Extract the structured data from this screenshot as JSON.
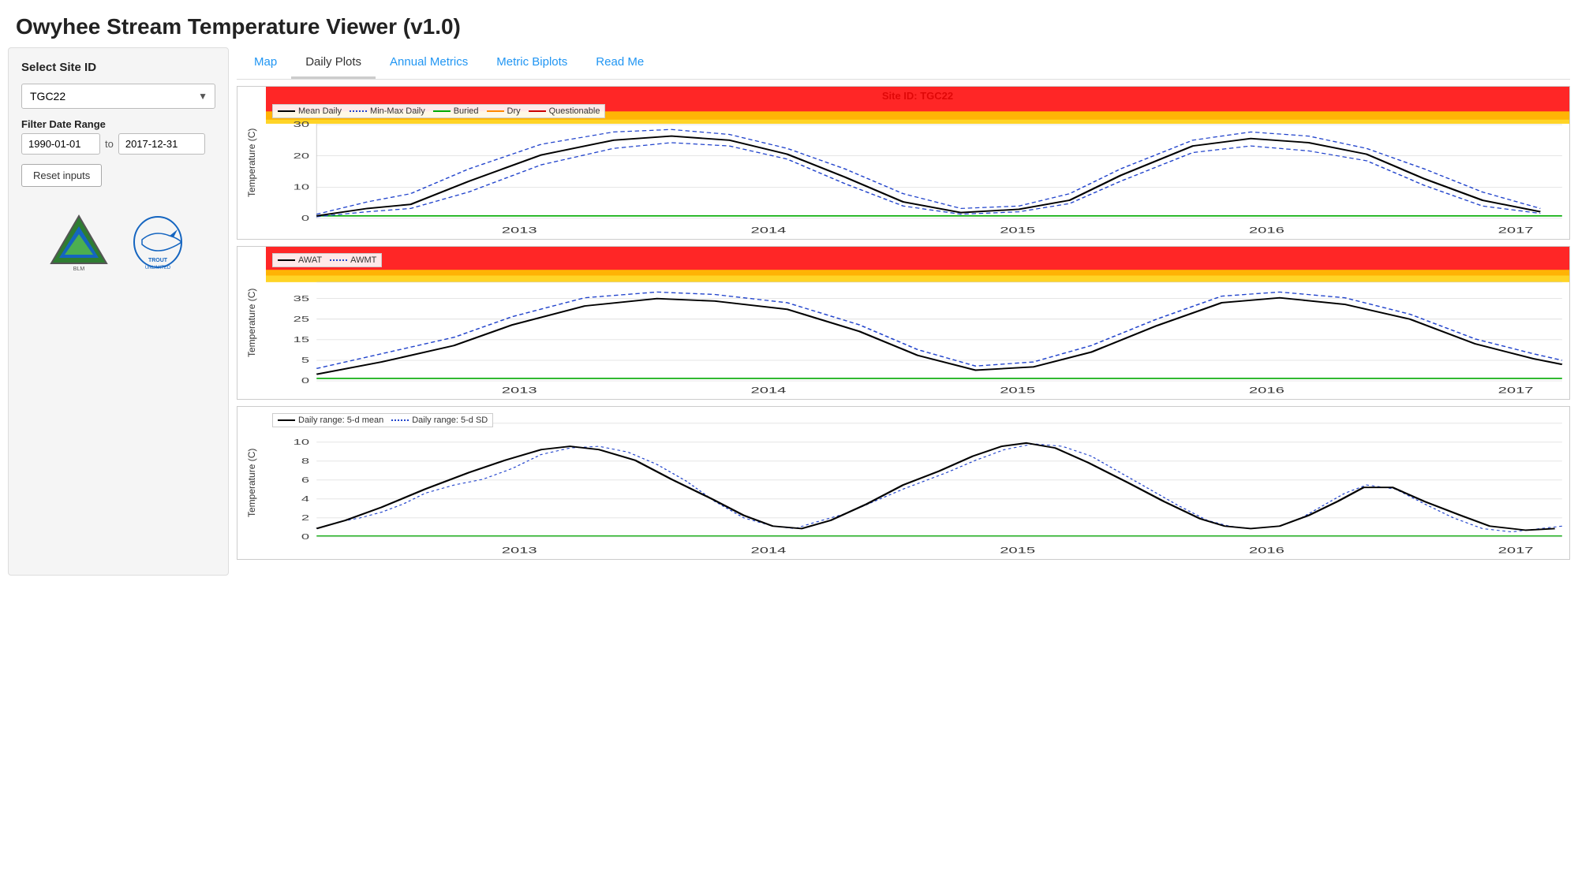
{
  "app": {
    "title": "Owyhee Stream Temperature Viewer (v1.0)"
  },
  "sidebar": {
    "site_label": "Select Site ID",
    "site_value": "TGC22",
    "site_options": [
      "TGC22"
    ],
    "filter_label": "Filter Date Range",
    "date_from": "1990-01-01",
    "date_to": "2017-12-31",
    "to_text": "to",
    "reset_label": "Reset inputs"
  },
  "tabs": [
    {
      "id": "map",
      "label": "Map",
      "active": false
    },
    {
      "id": "daily-plots",
      "label": "Daily Plots",
      "active": true
    },
    {
      "id": "annual-metrics",
      "label": "Annual Metrics",
      "active": false
    },
    {
      "id": "metric-biplots",
      "label": "Metric Biplots",
      "active": false
    },
    {
      "id": "read-me",
      "label": "Read Me",
      "active": false
    }
  ],
  "charts": {
    "site_id": "Site ID: TGC22",
    "chart1": {
      "y_label": "Temperature (C)",
      "legend": [
        {
          "label": "Mean Daily",
          "type": "solid",
          "color": "#000"
        },
        {
          "label": "Min-Max Daily",
          "type": "dotted",
          "color": "#2244cc"
        },
        {
          "label": "Buried",
          "type": "solid",
          "color": "#00aa00"
        },
        {
          "label": "Dry",
          "type": "solid",
          "color": "#ff8800"
        },
        {
          "label": "Questionable",
          "type": "solid",
          "color": "#cc0000"
        }
      ],
      "x_labels": [
        "2013",
        "2014",
        "2015",
        "2016",
        "2017"
      ],
      "y_ticks": [
        "0",
        "10",
        "20",
        "30"
      ]
    },
    "chart2": {
      "y_label": "Temperature (C)",
      "legend": [
        {
          "label": "AWAT",
          "type": "solid",
          "color": "#000"
        },
        {
          "label": "AWMT",
          "type": "dotted",
          "color": "#2244cc"
        }
      ],
      "x_labels": [
        "2013",
        "2014",
        "2015",
        "2016",
        "2017"
      ],
      "y_ticks": [
        "0",
        "5",
        "15",
        "25",
        "35"
      ]
    },
    "chart3": {
      "y_label": "Temperature (C)",
      "legend": [
        {
          "label": "Daily range: 5-d mean",
          "type": "solid",
          "color": "#000"
        },
        {
          "label": "Daily range: 5-d SD",
          "type": "dotted",
          "color": "#2244cc"
        }
      ],
      "x_labels": [
        "2013",
        "2014",
        "2015",
        "2016",
        "2017"
      ],
      "y_ticks": [
        "0",
        "2",
        "4",
        "6",
        "8",
        "10"
      ]
    }
  },
  "logos": {
    "blm_alt": "Bureau of Land Management",
    "tu_alt": "Trout Unlimited"
  }
}
